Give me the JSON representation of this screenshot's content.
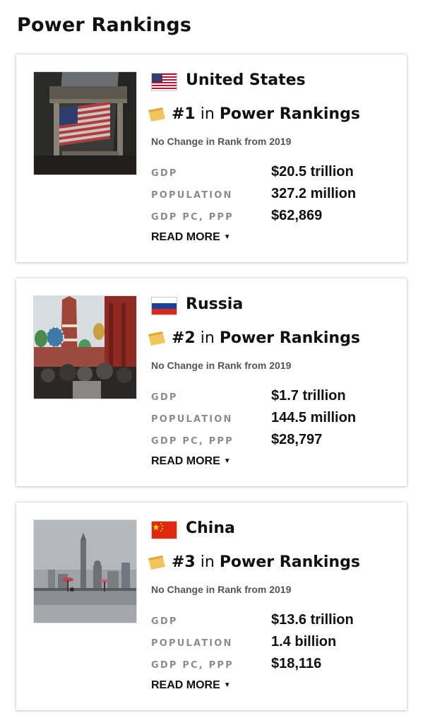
{
  "page_title": "Power Rankings",
  "colors": {
    "badge_gold": "#f2c55c",
    "label_gray": "#8c8c8c",
    "text_dark": "#111111"
  },
  "countries": [
    {
      "name": "United States",
      "flag_icon": "us-flag-icon",
      "image_icon": "new-york-stock-exchange-photo",
      "rank": "#1",
      "rank_in": "in",
      "rank_list": "Power Rankings",
      "change_text": "No Change in Rank from 2019",
      "stats": [
        {
          "label": "GDP",
          "value": "$20.5 trillion"
        },
        {
          "label": "POPULATION",
          "value": "327.2 million"
        },
        {
          "label": "GDP PC, PPP",
          "value": "$62,869"
        }
      ],
      "read_more": "READ MORE"
    },
    {
      "name": "Russia",
      "flag_icon": "russia-flag-icon",
      "image_icon": "red-square-photo",
      "rank": "#2",
      "rank_in": "in",
      "rank_list": "Power Rankings",
      "change_text": "No Change in Rank from 2019",
      "stats": [
        {
          "label": "GDP",
          "value": "$1.7 trillion"
        },
        {
          "label": "POPULATION",
          "value": "144.5 million"
        },
        {
          "label": "GDP PC, PPP",
          "value": "$28,797"
        }
      ],
      "read_more": "READ MORE"
    },
    {
      "name": "China",
      "flag_icon": "china-flag-icon",
      "image_icon": "shanghai-skyline-photo",
      "rank": "#3",
      "rank_in": "in",
      "rank_list": "Power Rankings",
      "change_text": "No Change in Rank from 2019",
      "stats": [
        {
          "label": "GDP",
          "value": "$13.6 trillion"
        },
        {
          "label": "POPULATION",
          "value": "1.4 billion"
        },
        {
          "label": "GDP PC, PPP",
          "value": "$18,116"
        }
      ],
      "read_more": "READ MORE"
    }
  ]
}
